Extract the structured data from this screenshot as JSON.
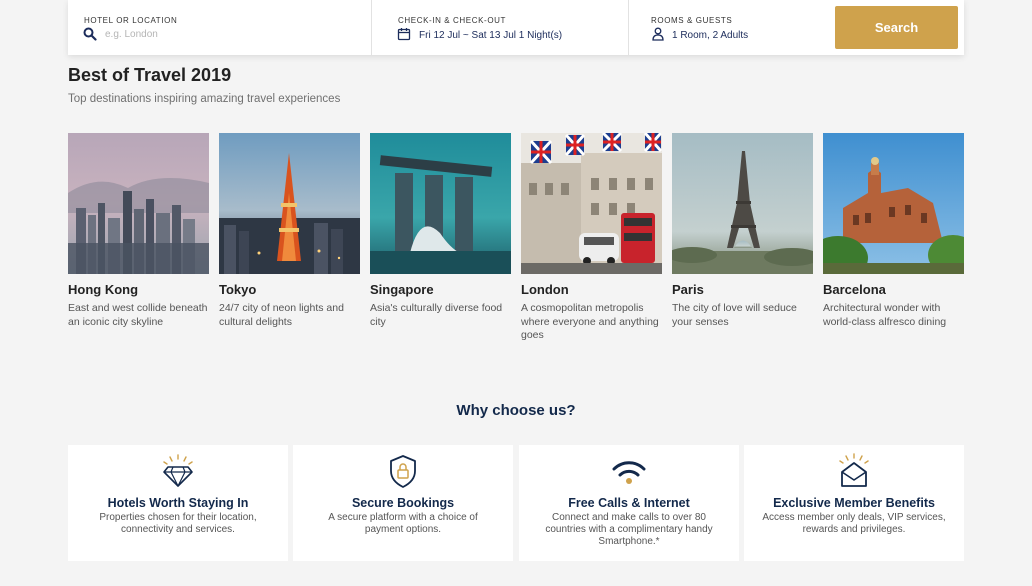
{
  "search": {
    "hotel_label": "HOTEL OR LOCATION",
    "hotel_placeholder": "e.g. London",
    "dates_label": "CHECK-IN & CHECK-OUT",
    "dates_value": "Fri 12 Jul ~ Sat 13 Jul  1 Night(s)",
    "rooms_label": "ROOMS & GUESTS",
    "rooms_value": "1 Room, 2 Adults",
    "button": "Search",
    "accent": "#cfa24c"
  },
  "best": {
    "title": "Best of Travel 2019",
    "subtitle": "Top destinations inspiring amazing travel experiences",
    "destinations": [
      {
        "name": "Hong Kong",
        "desc": "East and west collide beneath an iconic city skyline"
      },
      {
        "name": "Tokyo",
        "desc": "24/7 city of neon lights and cultural delights"
      },
      {
        "name": "Singapore",
        "desc": "Asia's culturally diverse food city"
      },
      {
        "name": "London",
        "desc": "A cosmopolitan metropolis where everyone and anything goes"
      },
      {
        "name": "Paris",
        "desc": "The city of love will seduce your senses"
      },
      {
        "name": "Barcelona",
        "desc": "Architectural wonder with world-class alfresco dining"
      }
    ]
  },
  "why": {
    "title": "Why choose us?",
    "features": [
      {
        "icon": "diamond-icon",
        "title": "Hotels Worth Staying In",
        "desc": "Properties chosen for their location, connectivity and services."
      },
      {
        "icon": "shield-lock-icon",
        "title": "Secure Bookings",
        "desc": "A secure platform with a choice of payment options."
      },
      {
        "icon": "wifi-icon",
        "title": "Free Calls & Internet",
        "desc": "Connect and make calls to over 80 countries with a complimentary handy Smartphone.*"
      },
      {
        "icon": "envelope-icon",
        "title": "Exclusive Member Benefits",
        "desc": "Access member only deals, VIP services, rewards and privileges."
      }
    ]
  },
  "colors": {
    "navy": "#13294b",
    "gold": "#cfa24c"
  }
}
